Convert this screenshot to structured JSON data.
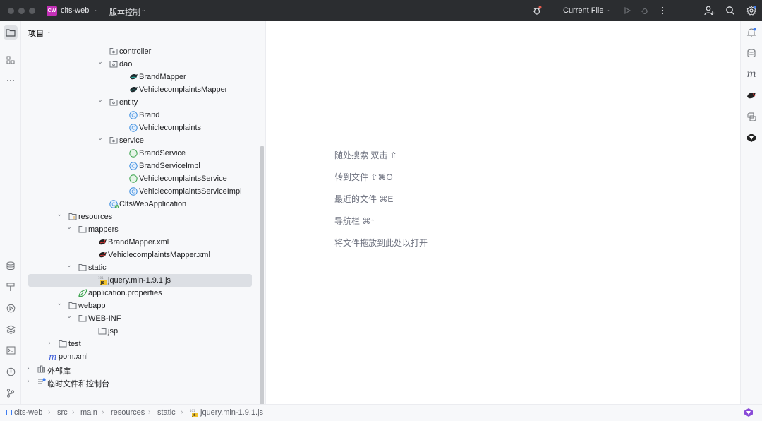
{
  "titlebar": {
    "project_badge": "CW",
    "project_name": "clts-web",
    "vcs_label": "版本控制",
    "run_config": "Current File",
    "icons": [
      "bug-badge-icon",
      "run-icon",
      "debug-icon",
      "more-icon",
      "add-user-icon",
      "search-icon",
      "settings-icon"
    ]
  },
  "left_toolbar": {
    "icons": [
      "project-folder-icon",
      "structure-icon",
      "more-dots-icon",
      "database-icon",
      "build-hammer-icon",
      "run-services-icon",
      "layers-icon",
      "terminal-icon",
      "problems-icon",
      "git-branch-icon"
    ]
  },
  "project_panel": {
    "title": "项目",
    "tree": [
      {
        "label": "controller",
        "icon": "package-folder",
        "indent": 0,
        "expanded": null
      },
      {
        "label": "dao",
        "icon": "package-folder",
        "indent": 0,
        "expanded": true
      },
      {
        "label": "BrandMapper",
        "icon": "mybatis-bird",
        "indent": 1,
        "expanded": null
      },
      {
        "label": "VehiclecomplaintsMapper",
        "icon": "mybatis-bird",
        "indent": 1,
        "expanded": null
      },
      {
        "label": "entity",
        "icon": "package-folder",
        "indent": 0,
        "expanded": true
      },
      {
        "label": "Brand",
        "icon": "class-c",
        "indent": 1,
        "expanded": null
      },
      {
        "label": "Vehiclecomplaints",
        "icon": "class-c",
        "indent": 1,
        "expanded": null
      },
      {
        "label": "service",
        "icon": "package-folder",
        "indent": 0,
        "expanded": true
      },
      {
        "label": "BrandService",
        "icon": "interface-i",
        "indent": 1,
        "expanded": null
      },
      {
        "label": "BrandServiceImpl",
        "icon": "class-c",
        "indent": 1,
        "expanded": null
      },
      {
        "label": "VehiclecomplaintsService",
        "icon": "interface-i",
        "indent": 1,
        "expanded": null
      },
      {
        "label": "VehiclecomplaintsServiceImpl",
        "icon": "class-c",
        "indent": 1,
        "expanded": null
      },
      {
        "label": "CltsWebApplication",
        "icon": "spring-class",
        "indent": 0,
        "expanded": null
      },
      {
        "label": "resources",
        "icon": "resources-folder",
        "indent": -3,
        "expanded": true
      },
      {
        "label": "mappers",
        "icon": "folder",
        "indent": -2,
        "expanded": true
      },
      {
        "label": "BrandMapper.xml",
        "icon": "mybatis-bird-red",
        "indent": -1,
        "expanded": null
      },
      {
        "label": "VehiclecomplaintsMapper.xml",
        "icon": "mybatis-bird-red",
        "indent": -1,
        "expanded": null
      },
      {
        "label": "static",
        "icon": "folder",
        "indent": -2,
        "expanded": true
      },
      {
        "label": "jquery.min-1.9.1.js",
        "icon": "js-file",
        "indent": -1,
        "expanded": null,
        "selected": true
      },
      {
        "label": "application.properties",
        "icon": "spring-leaf",
        "indent": -2,
        "expanded": null
      },
      {
        "label": "webapp",
        "icon": "folder",
        "indent": -3,
        "expanded": true
      },
      {
        "label": "WEB-INF",
        "icon": "folder",
        "indent": -2,
        "expanded": true
      },
      {
        "label": "jsp",
        "icon": "folder",
        "indent": -1,
        "expanded": null
      },
      {
        "label": "test",
        "icon": "folder",
        "indent": -4,
        "expanded": false
      },
      {
        "label": "pom.xml",
        "icon": "maven-m",
        "indent": -5,
        "expanded": null
      },
      {
        "label": "外部库",
        "icon": "library",
        "indent": -6,
        "expanded": false
      },
      {
        "label": "临时文件和控制台",
        "icon": "scratches",
        "indent": -6,
        "expanded": false
      }
    ]
  },
  "editor": {
    "hints": [
      "随处搜索 双击 ⇧",
      "转到文件 ⇧⌘O",
      "最近的文件 ⌘E",
      "导航栏 ⌘↑",
      "将文件拖放到此处以打开"
    ]
  },
  "right_toolbar": {
    "icons": [
      "notifications-icon",
      "database-icon",
      "maven-icon",
      "mybatis-icon",
      "python-icon",
      "ai-assistant-icon"
    ]
  },
  "statusbar": {
    "breadcrumbs": [
      "clts-web",
      "src",
      "main",
      "resources",
      "static",
      "jquery.min-1.9.1.js"
    ]
  },
  "colors": {
    "titlebar_bg": "#2b2d30",
    "panel_bg": "#f7f8fa",
    "selection_bg": "#dcdfe4",
    "class_icon": "#3c8ee0",
    "interface_icon": "#3aa34c",
    "accent_badge": "#c430b7"
  }
}
